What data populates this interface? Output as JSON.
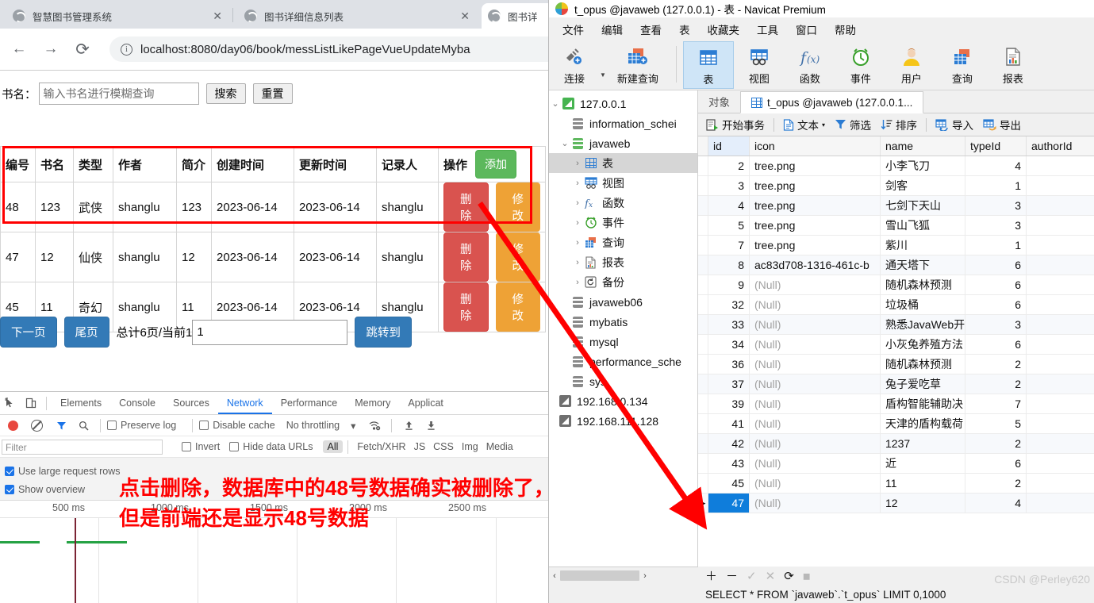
{
  "browser": {
    "tabs": [
      {
        "title": "智慧图书管理系统",
        "close": "✕",
        "active": false
      },
      {
        "title": "图书详细信息列表",
        "close": "✕",
        "active": false
      },
      {
        "title": "图书详",
        "close": "",
        "active": true
      }
    ],
    "nav": {
      "back": "←",
      "forward": "→",
      "reload": "⟳",
      "info": "ⓘ"
    },
    "omnibox": {
      "url": "localhost:8080/day06/book/messListLikePageVueUpdateMyba"
    }
  },
  "page": {
    "search": {
      "label": "书名：",
      "placeholder": "输入书名进行模糊查询",
      "value": "",
      "search_button": "搜索",
      "reset_button": "重置"
    },
    "table": {
      "headers": [
        "编号",
        "书名",
        "类型",
        "作者",
        "简介",
        "创建时间",
        "更新时间",
        "记录人",
        "操作"
      ],
      "add_button": "添加",
      "delete_button": "删除",
      "edit_button": "修改",
      "rows": [
        {
          "id": "48",
          "name": "123",
          "type": "武侠",
          "author": "shanglu",
          "desc": "123",
          "created": "2023-06-14",
          "updated": "2023-06-14",
          "recorder": "shanglu"
        },
        {
          "id": "47",
          "name": "12",
          "type": "仙侠",
          "author": "shanglu",
          "desc": "12",
          "created": "2023-06-14",
          "updated": "2023-06-14",
          "recorder": "shanglu"
        },
        {
          "id": "45",
          "name": "11",
          "type": "奇幻",
          "author": "shanglu",
          "desc": "11",
          "created": "2023-06-14",
          "updated": "2023-06-14",
          "recorder": "shanglu"
        }
      ]
    },
    "pager": {
      "next": "下一页",
      "last": "尾页",
      "summary": "总计6页/当前1",
      "page_input": "1",
      "jump": "跳转到"
    }
  },
  "devtools": {
    "tabs": [
      "Elements",
      "Console",
      "Sources",
      "Network",
      "Performance",
      "Memory",
      "Applicat"
    ],
    "selected_tab": "Network",
    "toolbar": {
      "preserve_log": "Preserve log",
      "disable_cache": "Disable cache",
      "throttling": "No throttling",
      "caret": "▾"
    },
    "filter": {
      "placeholder": "Filter",
      "invert": "Invert",
      "hide_data_urls": "Hide data URLs",
      "types": [
        "All",
        "Fetch/XHR",
        "JS",
        "CSS",
        "Img",
        "Media"
      ],
      "selected_type": "All"
    },
    "options": {
      "use_large_rows": "Use large request rows",
      "show_overview": "Show overview"
    },
    "overview": {
      "ticks": [
        "500 ms",
        "1000 ms",
        "1500 ms",
        "2000 ms",
        "2500 ms"
      ],
      "bar_color": "#25a244",
      "cursor_color": "#7b2434"
    }
  },
  "navicat": {
    "window_title": "t_opus @javaweb (127.0.0.1) - 表 - Navicat Premium",
    "menu": [
      "文件",
      "编辑",
      "查看",
      "表",
      "收藏夹",
      "工具",
      "窗口",
      "帮助"
    ],
    "toolbar": [
      {
        "label": "连接",
        "icon": "connection-icon"
      },
      {
        "label": "新建查询",
        "icon": "new-query-icon"
      },
      {
        "label": "表",
        "icon": "table-icon",
        "selected": true
      },
      {
        "label": "视图",
        "icon": "view-icon"
      },
      {
        "label": "函数",
        "icon": "function-icon"
      },
      {
        "label": "事件",
        "icon": "event-icon"
      },
      {
        "label": "用户",
        "icon": "user-icon"
      },
      {
        "label": "查询",
        "icon": "query-icon"
      },
      {
        "label": "报表",
        "icon": "report-icon"
      }
    ],
    "tree": [
      {
        "label": "127.0.0.1",
        "icon": "connection-green",
        "twisty": "⌄",
        "indent": 0
      },
      {
        "label": "information_schei",
        "icon": "db-gray",
        "twisty": "",
        "indent": 1
      },
      {
        "label": "javaweb",
        "icon": "db-green",
        "twisty": "⌄",
        "indent": 1
      },
      {
        "label": "表",
        "icon": "table-blue",
        "twisty": "›",
        "indent": 2,
        "selected": true
      },
      {
        "label": "视图",
        "icon": "view-blue",
        "twisty": "›",
        "indent": 2
      },
      {
        "label": "函数",
        "icon": "fx",
        "twisty": "›",
        "indent": 2
      },
      {
        "label": "事件",
        "icon": "clock",
        "twisty": "›",
        "indent": 2
      },
      {
        "label": "查询",
        "icon": "query",
        "twisty": "›",
        "indent": 2
      },
      {
        "label": "报表",
        "icon": "report",
        "twisty": "›",
        "indent": 2
      },
      {
        "label": "备份",
        "icon": "backup",
        "twisty": "›",
        "indent": 2
      },
      {
        "label": "javaweb06",
        "icon": "db-gray",
        "twisty": "",
        "indent": 1
      },
      {
        "label": "mybatis",
        "icon": "db-gray",
        "twisty": "",
        "indent": 1
      },
      {
        "label": "mysql",
        "icon": "db-gray",
        "twisty": "",
        "indent": 1
      },
      {
        "label": "performance_sche",
        "icon": "db-gray",
        "twisty": "",
        "indent": 1
      },
      {
        "label": "sys",
        "icon": "db-gray",
        "twisty": "",
        "indent": 1
      },
      {
        "label": "192.168.0.134",
        "icon": "connection-gray",
        "twisty": "",
        "indent": 0
      },
      {
        "label": "192.168.111.128",
        "icon": "connection-gray",
        "twisty": "",
        "indent": 0
      }
    ],
    "tabs": [
      {
        "label": "对象",
        "active": false
      },
      {
        "label": "t_opus @javaweb (127.0.0.1...",
        "active": true
      }
    ],
    "grid_toolbar": [
      {
        "label": "开始事务",
        "icon": "transaction-icon"
      },
      {
        "label": "文本",
        "icon": "text-icon",
        "caret": "▾"
      },
      {
        "label": "筛选",
        "icon": "filter-icon"
      },
      {
        "label": "排序",
        "icon": "sort-icon"
      },
      {
        "label": "导入",
        "icon": "import-icon"
      },
      {
        "label": "导出",
        "icon": "export-icon"
      }
    ],
    "grid": {
      "columns": [
        "id",
        "icon",
        "name",
        "typeId",
        "authorId"
      ],
      "rows": [
        {
          "id": "2",
          "icon": "tree.png",
          "name": "小李飞刀",
          "typeId": "4",
          "authorId": ""
        },
        {
          "id": "3",
          "icon": "tree.png",
          "name": "剑客",
          "typeId": "1",
          "authorId": ""
        },
        {
          "id": "4",
          "icon": "tree.png",
          "name": "七剑下天山",
          "typeId": "3",
          "authorId": ""
        },
        {
          "id": "5",
          "icon": "tree.png",
          "name": "雪山飞狐",
          "typeId": "3",
          "authorId": ""
        },
        {
          "id": "7",
          "icon": "tree.png",
          "name": "紫川",
          "typeId": "1",
          "authorId": ""
        },
        {
          "id": "8",
          "icon": "ac83d708-1316-461c-b",
          "name": "通天塔下",
          "typeId": "6",
          "authorId": ""
        },
        {
          "id": "9",
          "icon": "(Null)",
          "name": "随机森林预测",
          "typeId": "6",
          "authorId": ""
        },
        {
          "id": "32",
          "icon": "(Null)",
          "name": "垃圾桶",
          "typeId": "6",
          "authorId": ""
        },
        {
          "id": "33",
          "icon": "(Null)",
          "name": "熟悉JavaWeb开",
          "typeId": "3",
          "authorId": ""
        },
        {
          "id": "34",
          "icon": "(Null)",
          "name": "小灰兔养殖方法",
          "typeId": "6",
          "authorId": ""
        },
        {
          "id": "36",
          "icon": "(Null)",
          "name": "随机森林预测",
          "typeId": "2",
          "authorId": ""
        },
        {
          "id": "37",
          "icon": "(Null)",
          "name": "兔子爱吃草",
          "typeId": "2",
          "authorId": ""
        },
        {
          "id": "39",
          "icon": "(Null)",
          "name": "盾构智能辅助决",
          "typeId": "7",
          "authorId": ""
        },
        {
          "id": "41",
          "icon": "(Null)",
          "name": "天津的盾构载荷",
          "typeId": "5",
          "authorId": ""
        },
        {
          "id": "42",
          "icon": "(Null)",
          "name": "1237",
          "typeId": "2",
          "authorId": ""
        },
        {
          "id": "43",
          "icon": "(Null)",
          "name": "近",
          "typeId": "6",
          "authorId": ""
        },
        {
          "id": "45",
          "icon": "(Null)",
          "name": "11",
          "typeId": "2",
          "authorId": ""
        },
        {
          "id": "47",
          "icon": "(Null)",
          "name": "12",
          "typeId": "4",
          "authorId": "",
          "selected": true
        }
      ]
    },
    "record_nav": [
      "＋",
      "－",
      "✓",
      "✕",
      "⟳",
      "◼"
    ],
    "sql": "SELECT * FROM `javaweb`.`t_opus` LIMIT 0,1000",
    "watermark": "CSDN @Perley620"
  },
  "annotation": {
    "line1": "点击删除，数据库中的48号数据确实被删除了，",
    "line2": "但是前端还是显示48号数据",
    "color": "#ff0000"
  }
}
